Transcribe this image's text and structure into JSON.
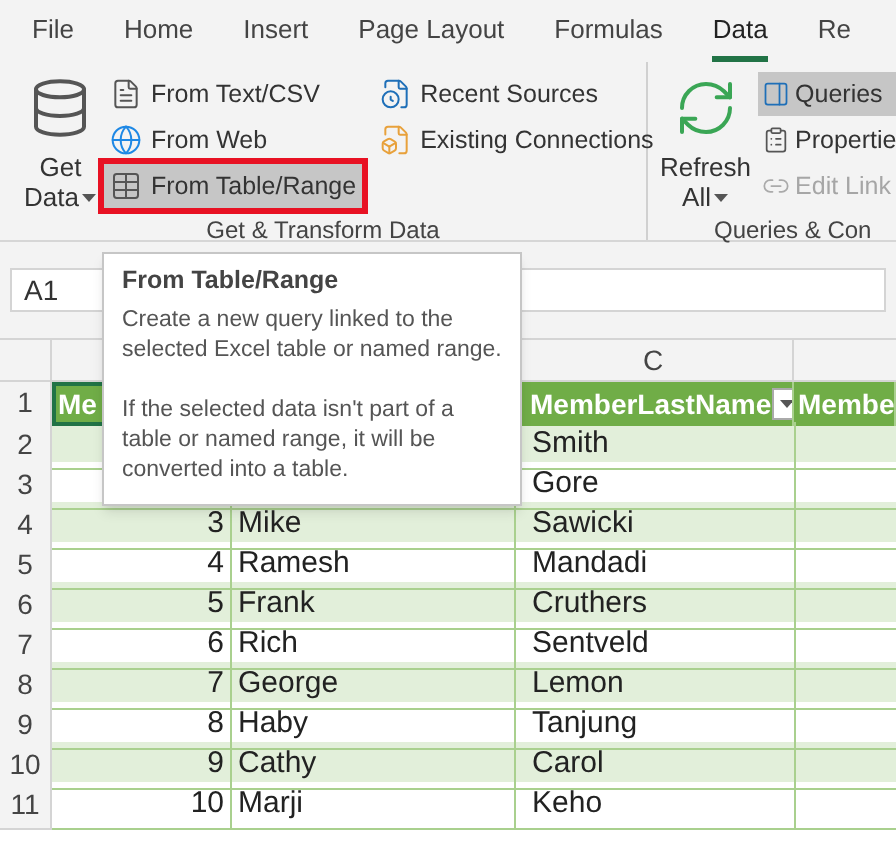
{
  "tabs": [
    {
      "label": "File",
      "selected": false
    },
    {
      "label": "Home",
      "selected": false
    },
    {
      "label": "Insert",
      "selected": false
    },
    {
      "label": "Page Layout",
      "selected": false
    },
    {
      "label": "Formulas",
      "selected": false
    },
    {
      "label": "Data",
      "selected": true
    },
    {
      "label": "Re",
      "selected": false
    }
  ],
  "ribbon": {
    "groups": [
      {
        "label": "Get & Transform Data",
        "big_button": {
          "kind": "database",
          "lines": [
            "Get",
            "Data"
          ],
          "dropdown": true
        },
        "columns": [
          [
            {
              "label": "From Text/CSV",
              "kind": "text_file",
              "selected": false,
              "disabled": false,
              "outlined": false
            },
            {
              "label": "From Web",
              "kind": "web",
              "selected": false,
              "disabled": false,
              "outlined": false
            },
            {
              "label": "From Table/Range",
              "kind": "table",
              "selected": true,
              "disabled": false,
              "outlined": true
            }
          ],
          [
            {
              "label": "Recent Sources",
              "kind": "recent",
              "selected": false,
              "disabled": false,
              "outlined": false
            },
            {
              "label": "Existing Connections",
              "kind": "connections",
              "selected": false,
              "disabled": false,
              "outlined": false
            }
          ]
        ]
      },
      {
        "label": "Queries & Con",
        "big_button": {
          "kind": "refresh",
          "lines": [
            "Refresh",
            "All"
          ],
          "dropdown": true
        },
        "columns": [
          [
            {
              "label": "Queries",
              "kind": "queries",
              "selected": true,
              "disabled": false,
              "outlined": false
            },
            {
              "label": "Propertie",
              "kind": "properties",
              "selected": false,
              "disabled": false,
              "outlined": false
            },
            {
              "label": "Edit Link",
              "kind": "links",
              "selected": false,
              "disabled": true,
              "outlined": false
            }
          ]
        ]
      }
    ]
  },
  "name_box": "A1",
  "visible_column_header": "C",
  "table": {
    "header": [
      "Me",
      "MemberLastName",
      "Membe"
    ],
    "rows": [
      {
        "row": "2",
        "last": "Smith"
      },
      {
        "row": "3",
        "last": "Gore"
      },
      {
        "row": "4",
        "id": "3",
        "first": "Mike",
        "last": "Sawicki"
      },
      {
        "row": "5",
        "id": "4",
        "first": "Ramesh",
        "last": "Mandadi"
      },
      {
        "row": "6",
        "id": "5",
        "first": "Frank",
        "last": "Cruthers"
      },
      {
        "row": "7",
        "id": "6",
        "first": "Rich",
        "last": "Sentveld"
      },
      {
        "row": "8",
        "id": "7",
        "first": "George",
        "last": "Lemon"
      },
      {
        "row": "9",
        "id": "8",
        "first": "Haby",
        "last": "Tanjung"
      },
      {
        "row": "10",
        "id": "9",
        "first": "Cathy",
        "last": "Carol"
      },
      {
        "row": "11",
        "id": "10",
        "first": "Marji",
        "last": "Keho"
      }
    ],
    "header_row": "1"
  },
  "tooltip": {
    "title": "From Table/Range",
    "paragraphs": [
      "Create a new query linked to the selected Excel table or named range.",
      "If the selected data isn't part of a table or named range, it will be converted into a table."
    ]
  }
}
